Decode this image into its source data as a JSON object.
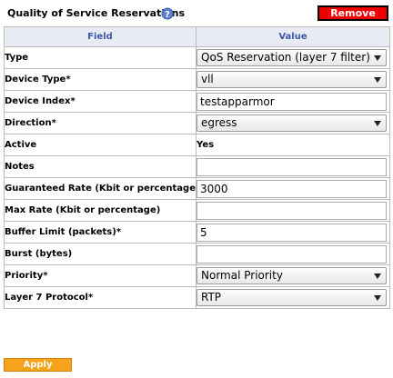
{
  "header": {
    "title": "Quality of Service Reservations",
    "remove_label": "Remove",
    "help_icon": "help-icon"
  },
  "colors": {
    "remove_bg": "#ee0000",
    "apply_bg": "#f6a21a",
    "header_text": "#3b5ba8",
    "header_bg": "#e8eaf4"
  },
  "table": {
    "columns": [
      "Field",
      "Value"
    ],
    "rows": {
      "type": {
        "label": "Type",
        "value": "QoS Reservation (layer 7 filter)"
      },
      "device_type": {
        "label": "Device Type*",
        "value": "vll"
      },
      "device_index": {
        "label": "Device Index*",
        "value": "testapparmor"
      },
      "direction": {
        "label": "Direction*",
        "value": "egress"
      },
      "active": {
        "label": "Active",
        "value": "Yes"
      },
      "notes": {
        "label": "Notes",
        "value": ""
      },
      "guaranteed_rate": {
        "label": "Guaranteed Rate (Kbit or percentage)*",
        "value": "3000"
      },
      "max_rate": {
        "label": "Max Rate (Kbit or percentage)",
        "value": ""
      },
      "buffer_limit": {
        "label": "Buffer Limit (packets)*",
        "value": "5"
      },
      "burst": {
        "label": "Burst (bytes)",
        "value": ""
      },
      "priority": {
        "label": "Priority*",
        "value": "Normal Priority"
      },
      "layer7_protocol": {
        "label": "Layer 7 Protocol*",
        "value": "RTP"
      }
    }
  },
  "footer": {
    "apply_label": "Apply"
  }
}
